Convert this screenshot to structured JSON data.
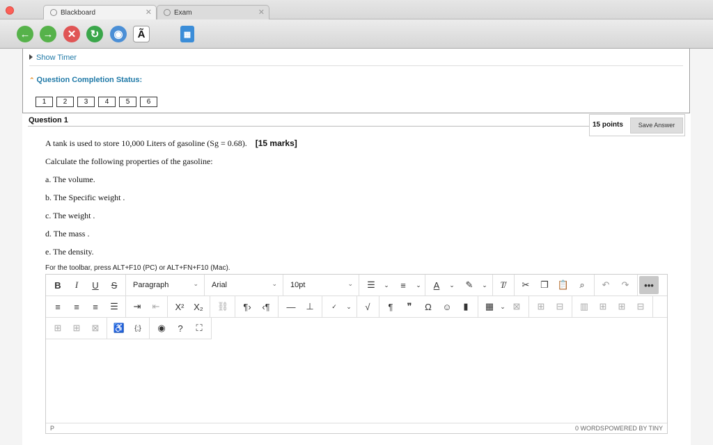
{
  "browser": {
    "tabs": [
      {
        "label": "Blackboard",
        "active": true
      },
      {
        "label": "Exam",
        "active": false
      }
    ],
    "toolbar_icons": [
      "back-icon",
      "forward-icon",
      "stop-icon",
      "refresh-icon",
      "globe-icon",
      "text-size-icon",
      "calculator-icon"
    ],
    "text_size_glyph": "Ã",
    "colors": {
      "close": "#fc5f57",
      "back": "#56b24a",
      "stop": "#e05555",
      "refresh": "#3aa64a",
      "accent": "#1f79a7"
    }
  },
  "status": {
    "show_timer": "Show Timer",
    "completion_label": "Question Completion Status:",
    "questions": [
      "1",
      "2",
      "3",
      "4",
      "5",
      "6"
    ]
  },
  "question": {
    "title": "Question 1",
    "points": "15 points",
    "save_label": "Save Answer",
    "line1": "A tank is used to store 10,000 Liters of gasoline (Sg = 0.68).",
    "marks": "[15 marks]",
    "line2": "Calculate the following properties of the gasoline:",
    "items": [
      "a. The volume.",
      "b. The Specific weight .",
      "c. The weight .",
      "d. The mass .",
      "e. The density."
    ]
  },
  "editor": {
    "hint": "For the toolbar, press ALT+F10 (PC) or ALT+FN+F10 (Mac).",
    "format": "Paragraph",
    "font": "Arial",
    "size": "10pt",
    "path": "P",
    "word_count": "0 WORDS",
    "powered": "POWERED BY TINY",
    "content": ""
  }
}
